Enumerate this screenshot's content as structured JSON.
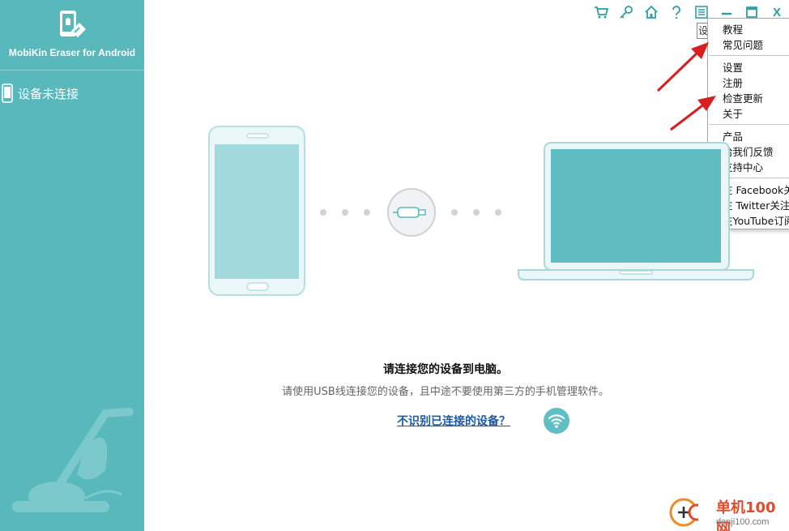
{
  "sidebar": {
    "app_name": "MobiKin Eraser for Android",
    "device_status": "设备未连接"
  },
  "toolbar": {
    "icons": [
      "cart-icon",
      "key-icon",
      "home-icon",
      "help-icon",
      "menu-icon",
      "minimize-icon",
      "maximize-icon",
      "close-icon"
    ],
    "close_label": "X",
    "tooltip_stub": "设"
  },
  "menu": {
    "group1": [
      "教程",
      "常见问题"
    ],
    "group2": [
      "设置",
      "注册",
      "检查更新",
      "关于"
    ],
    "group3": [
      "产品",
      "给我们反馈",
      "支持中心"
    ],
    "group4": [
      "在 Facebook关",
      "在 Twitter关注我",
      "在YouTube订阅"
    ]
  },
  "main": {
    "title": "请连接您的设备到电脑。",
    "subtitle": "请使用USB线连接您的设备，且中途不要使用第三方的手机管理软件。",
    "help_link": "不识别已连接的设备？"
  },
  "watermark": {
    "cn": "单机100网",
    "en": "danji100.com"
  },
  "colors": {
    "sidebar": "#58b8bc",
    "accent": "#2f9ea3",
    "link": "#1a5aa8",
    "arrow": "#d81e1e"
  }
}
